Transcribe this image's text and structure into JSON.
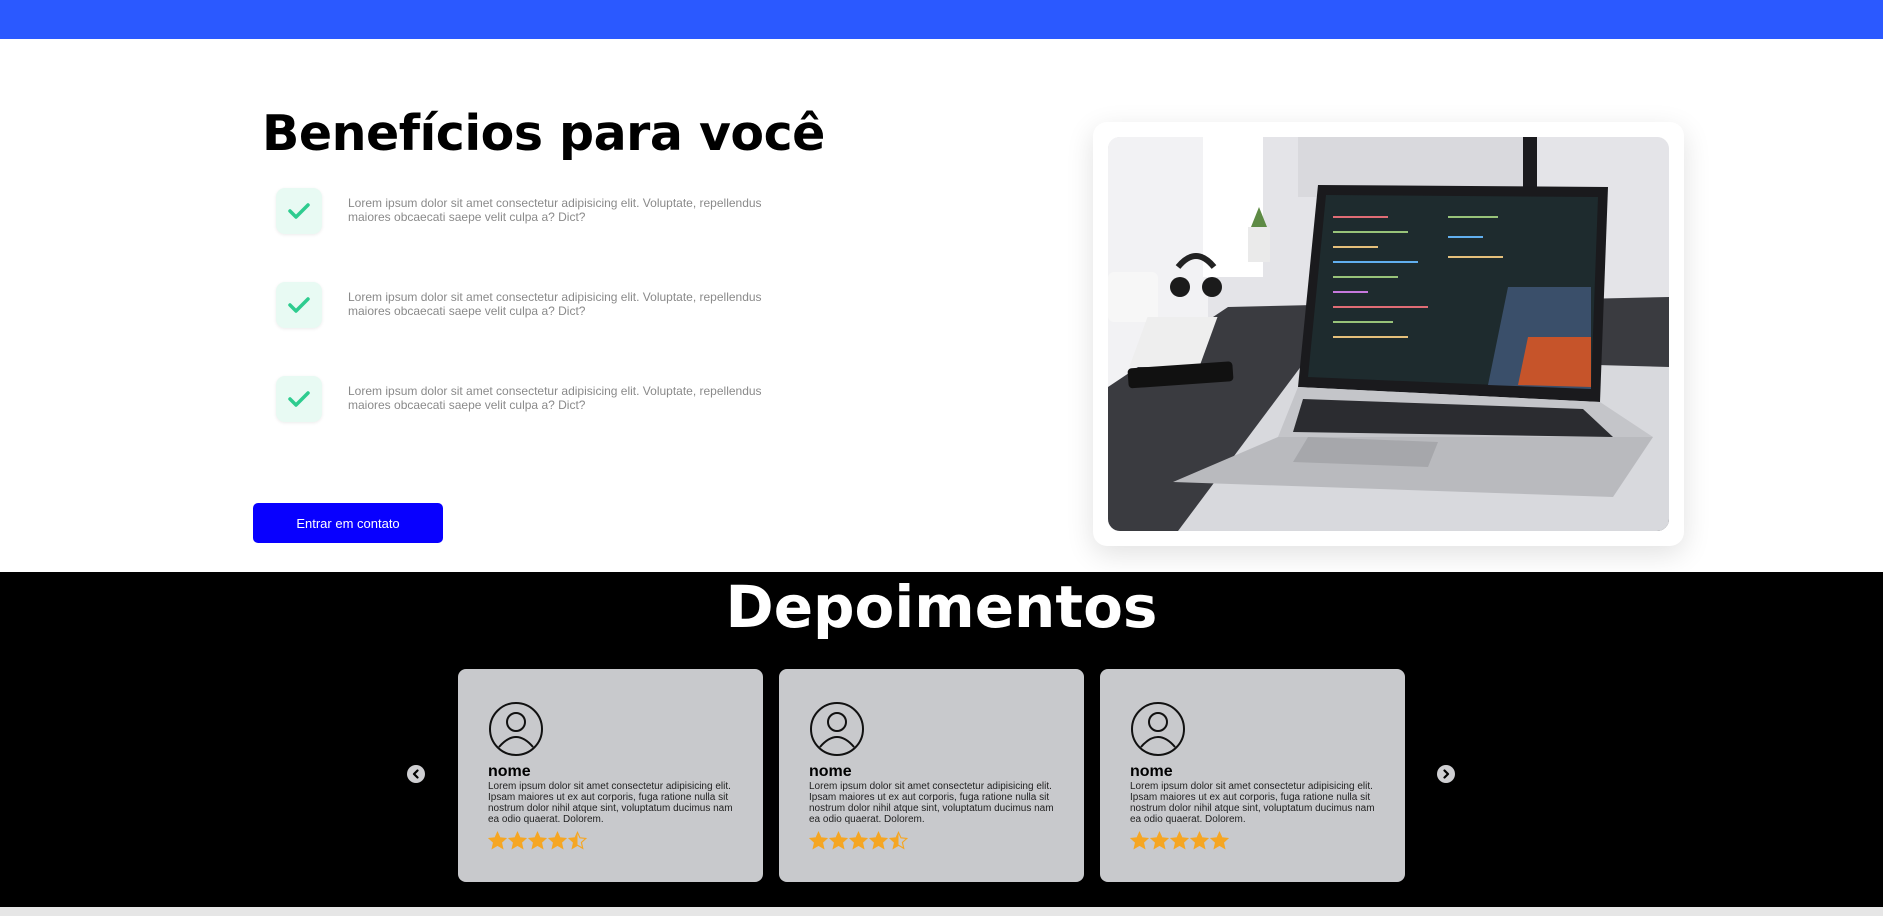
{
  "benefits": {
    "title": "Benefícios para você",
    "items": [
      {
        "text": "Lorem ipsum dolor sit amet consectetur adipisicing elit. Voluptate, repellendus maiores obcaecati saepe velit culpa a? Dict?"
      },
      {
        "text": "Lorem ipsum dolor sit amet consectetur adipisicing elit. Voluptate, repellendus maiores obcaecati saepe velit culpa a? Dict?"
      },
      {
        "text": "Lorem ipsum dolor sit amet consectetur adipisicing elit. Voluptate, repellendus maiores obcaecati saepe velit culpa a? Dict?"
      }
    ],
    "button_label": "Entrar em contato",
    "check_icon": "check-icon",
    "accent_color": "#2ecc8f"
  },
  "testimonials": {
    "title": "Depoimentos",
    "prev_icon": "chevron-left-icon",
    "next_icon": "chevron-right-icon",
    "cards": [
      {
        "name": "nome",
        "text": "Lorem ipsum dolor sit amet consectetur adipisicing elit. Ipsam maiores ut ex aut corporis, fuga ratione nulla sit nostrum dolor nihil atque sint, voluptatum ducimus nam ea odio quaerat. Dolorem.",
        "rating": 4.5
      },
      {
        "name": "nome",
        "text": "Lorem ipsum dolor sit amet consectetur adipisicing elit. Ipsam maiores ut ex aut corporis, fuga ratione nulla sit nostrum dolor nihil atque sint, voluptatum ducimus nam ea odio quaerat. Dolorem.",
        "rating": 4.5
      },
      {
        "name": "nome",
        "text": "Lorem ipsum dolor sit amet consectetur adipisicing elit. Ipsam maiores ut ex aut corporis, fuga ratione nulla sit nostrum dolor nihil atque sint, voluptatum ducimus nam ea odio quaerat. Dolorem.",
        "rating": 5
      }
    ],
    "star_color": "#f5a623"
  },
  "colors": {
    "topbar": "#2b59ff",
    "button": "#0800ff",
    "testimonials_bg": "#000000",
    "card_bg": "#c8c9cc"
  }
}
